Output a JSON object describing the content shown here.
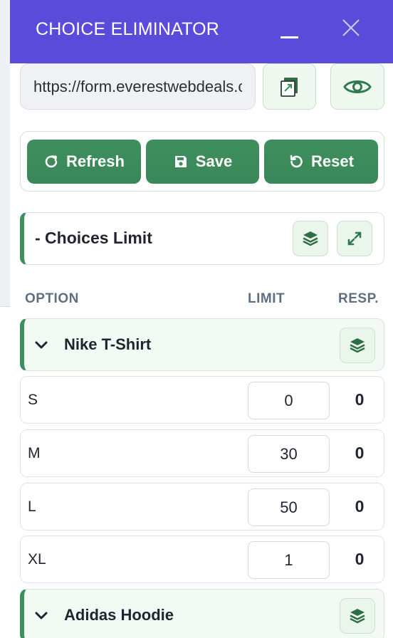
{
  "window": {
    "title": "CHOICE ELIMINATOR",
    "accent_color": "#5b4bdb",
    "minimize_icon": "minimize-icon",
    "close_icon": "close-icon"
  },
  "url_bar": {
    "value": "https://form.everestwebdeals.co",
    "copy_icon": "copy-link-icon",
    "view_icon": "eye-icon"
  },
  "toolbar": {
    "refresh_label": "Refresh",
    "save_label": "Save",
    "reset_label": "Reset",
    "button_color": "#3f8f5e"
  },
  "section": {
    "title": "- Choices Limit",
    "layers_icon": "layers-icon",
    "expand_icon": "expand-icon"
  },
  "table": {
    "headers": {
      "option": "OPTION",
      "limit": "LIMIT",
      "responses": "RESP."
    },
    "groups": [
      {
        "name": "Nike T-Shirt",
        "expanded": true,
        "rows": [
          {
            "option": "S",
            "limit": "0",
            "responses": "0"
          },
          {
            "option": "M",
            "limit": "30",
            "responses": "0"
          },
          {
            "option": "L",
            "limit": "50",
            "responses": "0"
          },
          {
            "option": "XL",
            "limit": "1",
            "responses": "0"
          }
        ]
      },
      {
        "name": "Adidas Hoodie",
        "expanded": true,
        "rows": []
      }
    ]
  }
}
